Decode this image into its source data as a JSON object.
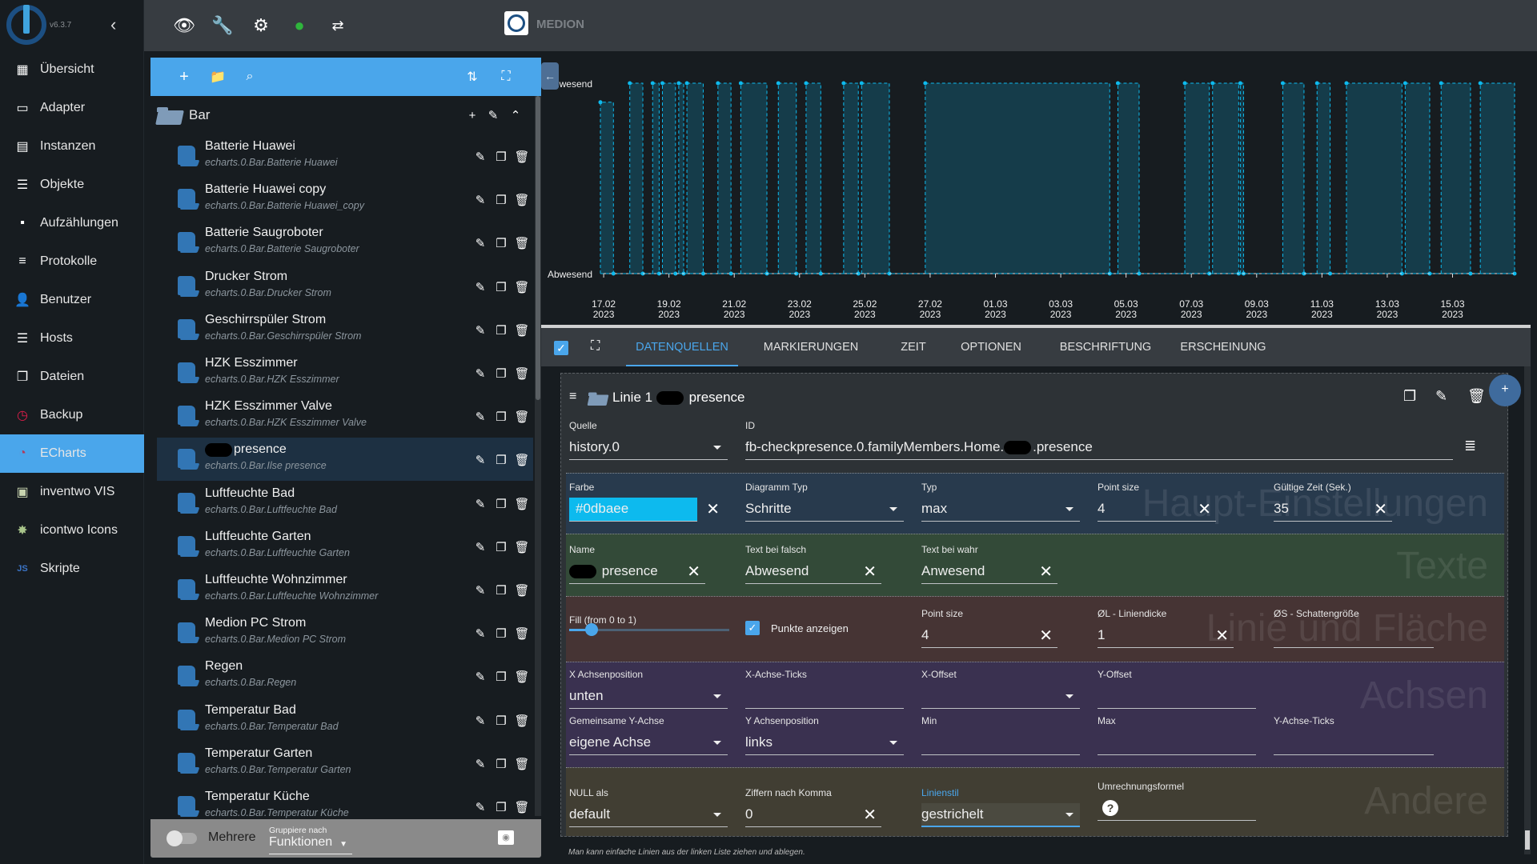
{
  "app": {
    "version": "v6.3.7",
    "host_name": "MEDION"
  },
  "sidebar": {
    "items": [
      {
        "label": "Übersicht",
        "icon": "grid-icon"
      },
      {
        "label": "Adapter",
        "icon": "store-icon"
      },
      {
        "label": "Instanzen",
        "icon": "instances-icon"
      },
      {
        "label": "Objekte",
        "icon": "list-icon"
      },
      {
        "label": "Aufzählungen",
        "icon": "enum-icon"
      },
      {
        "label": "Protokolle",
        "icon": "logs-icon"
      },
      {
        "label": "Benutzer",
        "icon": "user-icon"
      },
      {
        "label": "Hosts",
        "icon": "hosts-icon"
      },
      {
        "label": "Dateien",
        "icon": "files-icon"
      },
      {
        "label": "Backup",
        "icon": "backup-icon"
      },
      {
        "label": "ECharts",
        "icon": "echarts-icon",
        "active": true
      },
      {
        "label": "inventwo VIS",
        "icon": "inventwo-icon"
      },
      {
        "label": "icontwo Icons",
        "icon": "icontwo-icon"
      },
      {
        "label": "Skripte",
        "icon": "js-icon"
      }
    ]
  },
  "tree": {
    "folder": "Bar",
    "items": [
      {
        "title": "Batterie Huawei",
        "id": "echarts.0.Bar.Batterie Huawei"
      },
      {
        "title": "Batterie Huawei copy",
        "id": "echarts.0.Bar.Batterie Huawei_copy"
      },
      {
        "title": "Batterie Saugroboter",
        "id": "echarts.0.Bar.Batterie Saugroboter"
      },
      {
        "title": "Drucker Strom",
        "id": "echarts.0.Bar.Drucker Strom"
      },
      {
        "title": "Geschirrspüler Strom",
        "id": "echarts.0.Bar.Geschirrspüler Strom"
      },
      {
        "title": "HZK Esszimmer",
        "id": "echarts.0.Bar.HZK Esszimmer"
      },
      {
        "title": "HZK Esszimmer Valve",
        "id": "echarts.0.Bar.HZK Esszimmer Valve"
      },
      {
        "title": "presence",
        "id": "echarts.0.Bar.Ilse presence",
        "selected": true,
        "redacted": true
      },
      {
        "title": "Luftfeuchte Bad",
        "id": "echarts.0.Bar.Luftfeuchte Bad"
      },
      {
        "title": "Luftfeuchte Garten",
        "id": "echarts.0.Bar.Luftfeuchte Garten"
      },
      {
        "title": "Luftfeuchte Wohnzimmer",
        "id": "echarts.0.Bar.Luftfeuchte Wohnzimmer"
      },
      {
        "title": "Medion PC Strom",
        "id": "echarts.0.Bar.Medion PC Strom"
      },
      {
        "title": "Regen",
        "id": "echarts.0.Bar.Regen"
      },
      {
        "title": "Temperatur Bad",
        "id": "echarts.0.Bar.Temperatur Bad"
      },
      {
        "title": "Temperatur Garten",
        "id": "echarts.0.Bar.Temperatur Garten"
      },
      {
        "title": "Temperatur Küche",
        "id": "echarts.0.Bar.Temperatur Küche"
      }
    ],
    "bottom": {
      "multi_label": "Mehrere",
      "multi_on": false,
      "group_label": "Gruppiere nach",
      "group_value": "Funktionen"
    }
  },
  "tabs": [
    {
      "label": "DATENQUELLEN",
      "active": true
    },
    {
      "label": "MARKIERUNGEN"
    },
    {
      "label": "ZEIT"
    },
    {
      "label": "OPTIONEN"
    },
    {
      "label": "BESCHRIFTUNG"
    },
    {
      "label": "ERSCHEINUNG"
    }
  ],
  "line": {
    "title_prefix": "Linie 1",
    "title_suffix": "presence",
    "quelle": {
      "label": "Quelle",
      "value": "history.0"
    },
    "id": {
      "label": "ID",
      "value": "fb-checkpresence.0.familyMembers.Home.",
      "value_suffix": ".presence"
    },
    "sections": {
      "main": {
        "watermark": "Haupt-Einstellungen",
        "farbe": {
          "label": "Farbe",
          "value": "#0dbaee"
        },
        "diagramm_typ": {
          "label": "Diagramm Typ",
          "value": "Schritte"
        },
        "typ": {
          "label": "Typ",
          "value": "max"
        },
        "point_size": {
          "label": "Point size",
          "value": "4"
        },
        "gueltige_zeit": {
          "label": "Gültige Zeit (Sek.)",
          "value": "35"
        }
      },
      "texts": {
        "watermark": "Texte",
        "name": {
          "label": "Name",
          "value": "presence"
        },
        "text_false": {
          "label": "Text bei falsch",
          "value": "Abwesend"
        },
        "text_true": {
          "label": "Text bei wahr",
          "value": "Anwesend"
        }
      },
      "line_area": {
        "watermark": "Linie und Fläche",
        "fill": {
          "label": "Fill (from 0 to 1)",
          "value": 0.1
        },
        "punkte": {
          "label": "Punkte anzeigen",
          "checked": true
        },
        "point_size": {
          "label": "Point size",
          "value": "4"
        },
        "liniendicke": {
          "label": "ØL - Liniendicke",
          "value": "1"
        },
        "schatten": {
          "label": "ØS - Schattengröße",
          "value": ""
        }
      },
      "axes": {
        "watermark": "Achsen",
        "x_pos": {
          "label": "X Achsenposition",
          "value": "unten"
        },
        "x_ticks": {
          "label": "X-Achse-Ticks",
          "value": ""
        },
        "x_offset": {
          "label": "X-Offset",
          "value": ""
        },
        "y_offset": {
          "label": "Y-Offset",
          "value": ""
        },
        "common_y": {
          "label": "Gemeinsame Y-Achse",
          "value": "eigene Achse"
        },
        "y_pos": {
          "label": "Y Achsenposition",
          "value": "links"
        },
        "min": {
          "label": "Min",
          "value": ""
        },
        "max": {
          "label": "Max",
          "value": ""
        },
        "y_ticks": {
          "label": "Y-Achse-Ticks",
          "value": ""
        }
      },
      "other": {
        "watermark": "Andere",
        "null_als": {
          "label": "NULL als",
          "value": "default"
        },
        "ziffern": {
          "label": "Ziffern nach Komma",
          "value": "0"
        },
        "linienstil": {
          "label": "Linienstil",
          "value": "gestrichelt"
        },
        "formel": {
          "label": "Umrechnungsformel",
          "value": ""
        }
      }
    }
  },
  "hint": "Man kann einfache Linien aus der linken Liste ziehen und ablegen.",
  "colors": {
    "accent": "#4aa6eb",
    "line": "#0dbaee",
    "fill": "#15404f"
  },
  "chart_data": {
    "type": "line",
    "step": true,
    "title": "",
    "xlabel": "",
    "ylabel": "",
    "y_categories": [
      "Abwesend",
      "Anwesend"
    ],
    "x_ticks": [
      "17.02\n2023",
      "19.02\n2023",
      "21.02\n2023",
      "23.02\n2023",
      "25.02\n2023",
      "27.02\n2023",
      "01.03\n2023",
      "03.03\n2023",
      "05.03\n2023",
      "07.03\n2023",
      "09.03\n2023",
      "11.03\n2023",
      "13.03\n2023",
      "15.03\n2023"
    ],
    "x_range_days_from_17_02": [
      -0.1,
      27.9
    ],
    "series": [
      {
        "name": "presence",
        "present_intervals_days_from_17_02": [
          [
            -0.1,
            0.3,
            0.9
          ],
          [
            0.8,
            1.2,
            1
          ],
          [
            1.5,
            1.7,
            1
          ],
          [
            1.8,
            2.2,
            1
          ],
          [
            2.3,
            2.45,
            1
          ],
          [
            2.55,
            3.05,
            1
          ],
          [
            3.5,
            3.9,
            1
          ],
          [
            4.2,
            5.0,
            1
          ],
          [
            5.35,
            5.9,
            1
          ],
          [
            6.2,
            6.65,
            1
          ],
          [
            7.35,
            7.8,
            1
          ],
          [
            7.9,
            8.75,
            1
          ],
          [
            9.85,
            15.5,
            1
          ],
          [
            15.75,
            16.4,
            1
          ],
          [
            17.8,
            18.55,
            1
          ],
          [
            18.65,
            19.45,
            1
          ],
          [
            19.5,
            19.6,
            1
          ],
          [
            20.8,
            21.45,
            1
          ],
          [
            21.85,
            22.25,
            1
          ],
          [
            22.75,
            24.45,
            1
          ],
          [
            24.55,
            25.3,
            1
          ],
          [
            25.65,
            26.55,
            1
          ],
          [
            26.85,
            27.9,
            1
          ]
        ]
      }
    ]
  }
}
